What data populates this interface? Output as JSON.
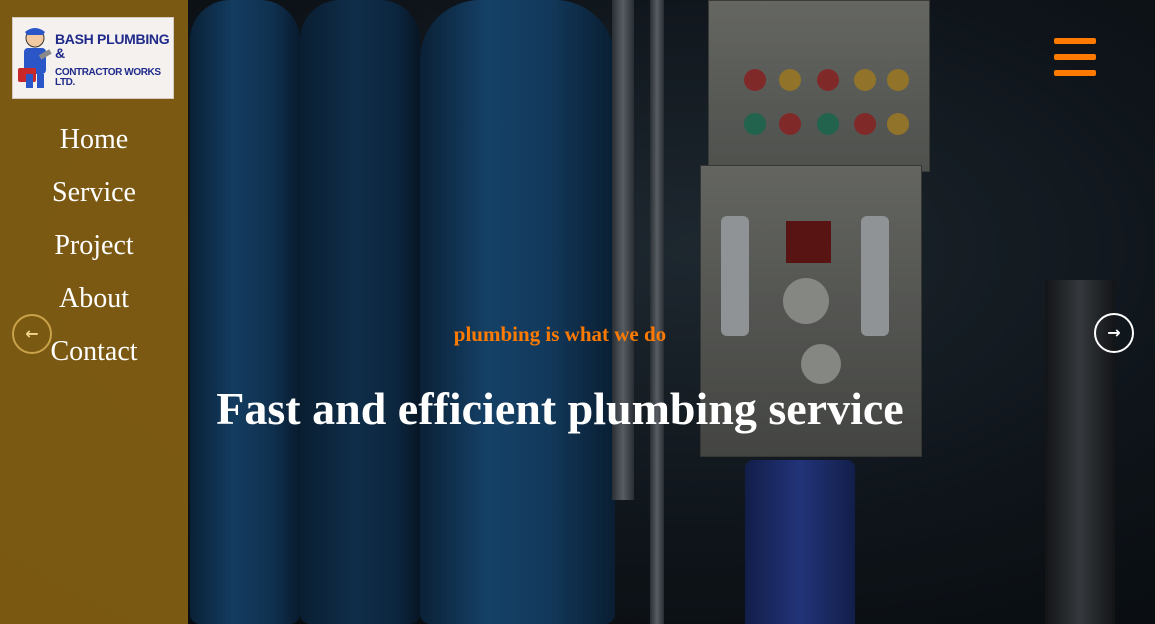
{
  "brand": {
    "logo_line1": "BASH PLUMBING &",
    "logo_line2": "CONTRACTOR WORKS LTD.",
    "accent_color": "#ff7a00",
    "sidebar_color": "#84601a"
  },
  "nav": {
    "items": [
      {
        "label": "Home"
      },
      {
        "label": "Service"
      },
      {
        "label": "Project"
      },
      {
        "label": "About"
      },
      {
        "label": "Contact"
      }
    ]
  },
  "header": {
    "menu_icon": "hamburger-menu-icon"
  },
  "carousel": {
    "prev_icon": "arrow-left-icon",
    "next_icon": "arrow-right-icon",
    "slide": {
      "tagline": "plumbing is what we do",
      "headline": "Fast and efficient plumbing service"
    }
  }
}
